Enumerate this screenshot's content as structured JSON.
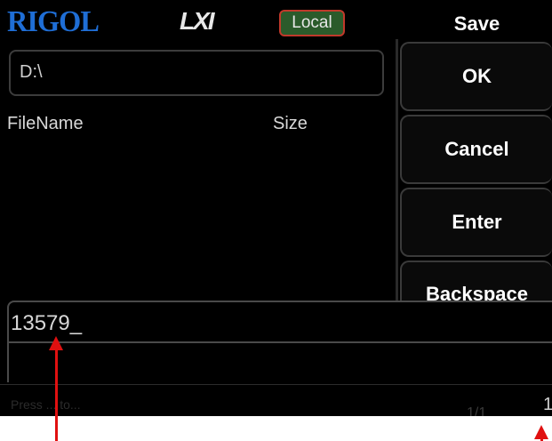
{
  "header": {
    "brand": "RIGOL",
    "lxi": "LXI",
    "mode_badge": "Local",
    "menu_title": "Save"
  },
  "browser": {
    "current_path": "D:\\",
    "columns": [
      "FileName",
      "Size"
    ]
  },
  "softkeys": [
    {
      "label": "OK"
    },
    {
      "label": "Cancel"
    },
    {
      "label": "Enter"
    },
    {
      "label": "Backspace"
    }
  ],
  "filename_input": {
    "value": "13579_"
  },
  "status": {
    "hint": "Press ... to...",
    "page": "1/1",
    "edge_digit": "1"
  },
  "colors": {
    "brand": "#1f6ed6",
    "badge_border": "#c0392b",
    "badge_fill": "#2b5b2b",
    "annotation_arrow": "#e01010"
  }
}
